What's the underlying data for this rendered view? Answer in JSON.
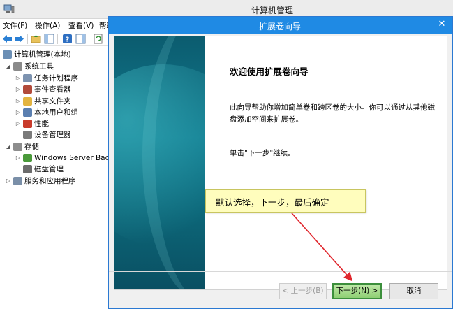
{
  "main_window": {
    "title": "计算机管理"
  },
  "menu": {
    "items": [
      "文件(F)",
      "操作(A)",
      "查看(V)",
      "帮助"
    ]
  },
  "tree": {
    "items": [
      {
        "label": "计算机管理(本地)",
        "icon": "computer-icon",
        "color": "#6b8fb5"
      },
      {
        "label": "系统工具",
        "icon": "tools-icon",
        "color": "#8a8a8a"
      },
      {
        "label": "任务计划程序",
        "icon": "clock-icon",
        "color": "#7d93b0"
      },
      {
        "label": "事件查看器",
        "icon": "event-viewer-icon",
        "color": "#b24a3a"
      },
      {
        "label": "共享文件夹",
        "icon": "shared-folder-icon",
        "color": "#e3b440"
      },
      {
        "label": "本地用户和组",
        "icon": "users-icon",
        "color": "#5a7fb0"
      },
      {
        "label": "性能",
        "icon": "performance-icon",
        "color": "#c93b2b"
      },
      {
        "label": "设备管理器",
        "icon": "device-manager-icon",
        "color": "#7a7a7a"
      },
      {
        "label": "存储",
        "icon": "storage-icon",
        "color": "#8d8d8d"
      },
      {
        "label": "Windows Server Back",
        "icon": "backup-icon",
        "color": "#4a9a3a"
      },
      {
        "label": "磁盘管理",
        "icon": "disk-icon",
        "color": "#6c6c6c"
      },
      {
        "label": "服务和应用程序",
        "icon": "services-icon",
        "color": "#7a8fa8"
      }
    ]
  },
  "dialog": {
    "title": "扩展卷向导",
    "welcome_title": "欢迎使用扩展卷向导",
    "intro_text": "此向导帮助你增加简单卷和跨区卷的大小。你可以通过从其他磁盘添加空间来扩展卷。",
    "next_hint": "单击\"下一步\"继续。",
    "back_label": "< 上一步(B)",
    "next_label": "下一步(N) >",
    "cancel_label": "取消",
    "close_glyph": "✕"
  },
  "annotation": {
    "text": "默认选择，下一步，最后确定",
    "arrow_color": "#e0262d"
  },
  "colors": {
    "dialog_titlebar": "#1f8ae4",
    "next_button": "#8fcf74"
  }
}
